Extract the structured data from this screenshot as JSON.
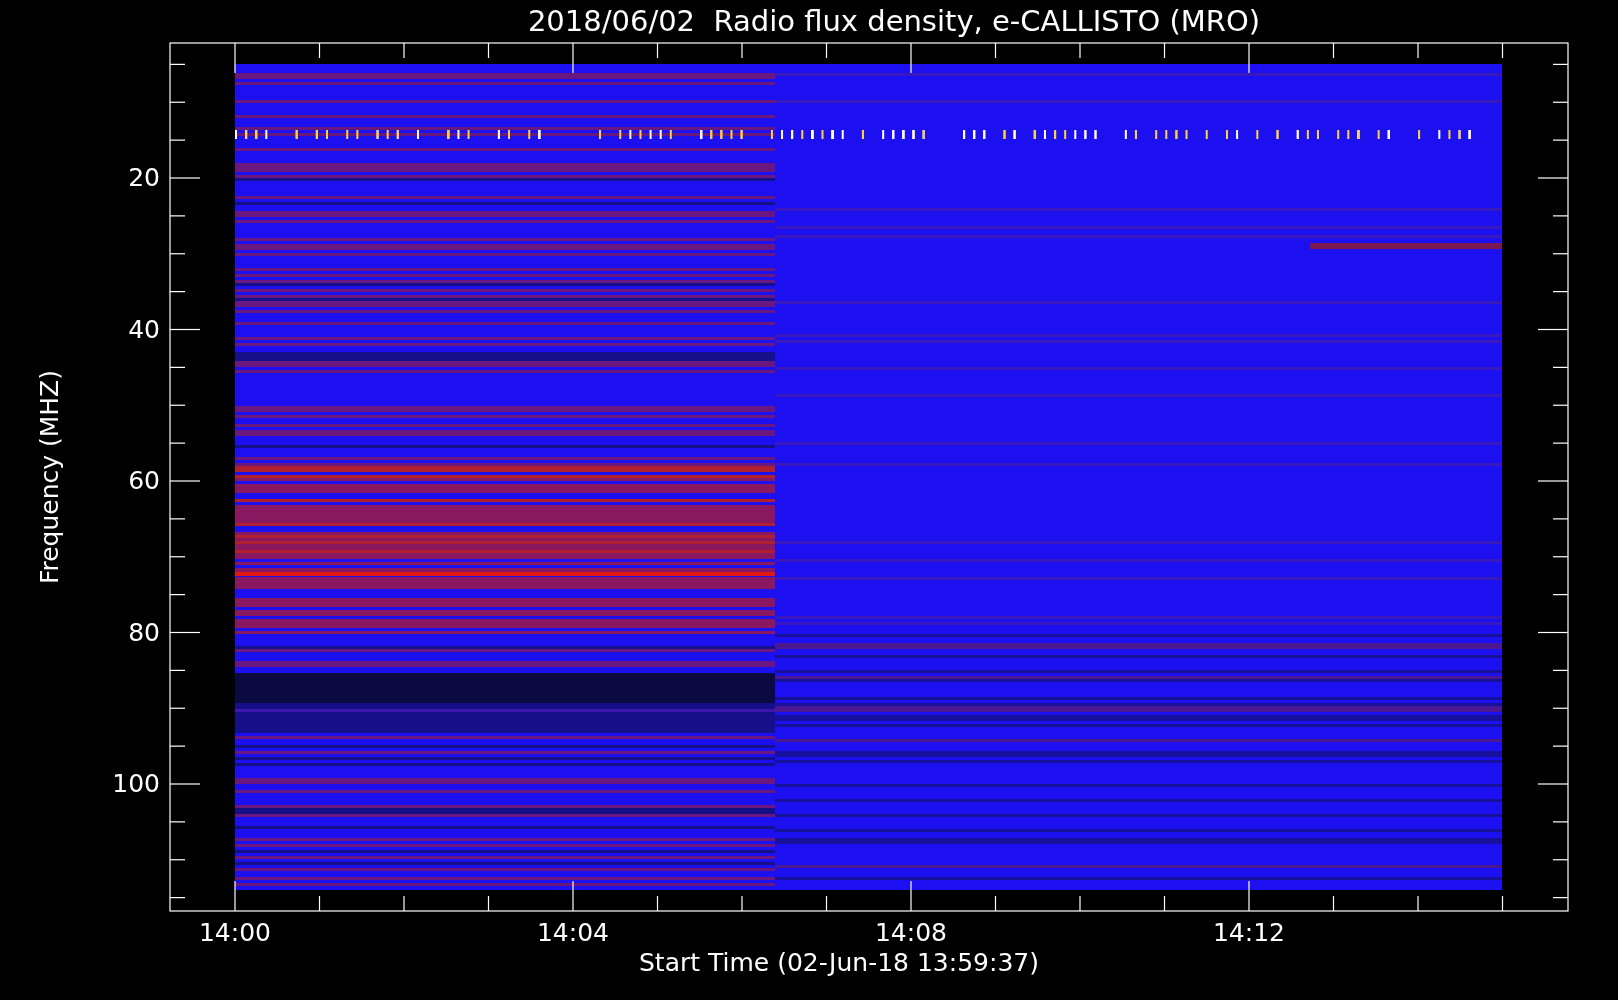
{
  "title": "2018/06/02  Radio flux density, e-CALLISTO (MRO)",
  "y_axis": {
    "label": "Frequency (MHZ)",
    "ticks": [
      "20",
      "40",
      "60",
      "80",
      "100"
    ]
  },
  "x_axis": {
    "label": "Start Time (02-Jun-18 13:59:37)",
    "ticks": [
      "14:00",
      "14:04",
      "14:08",
      "14:12"
    ]
  }
}
